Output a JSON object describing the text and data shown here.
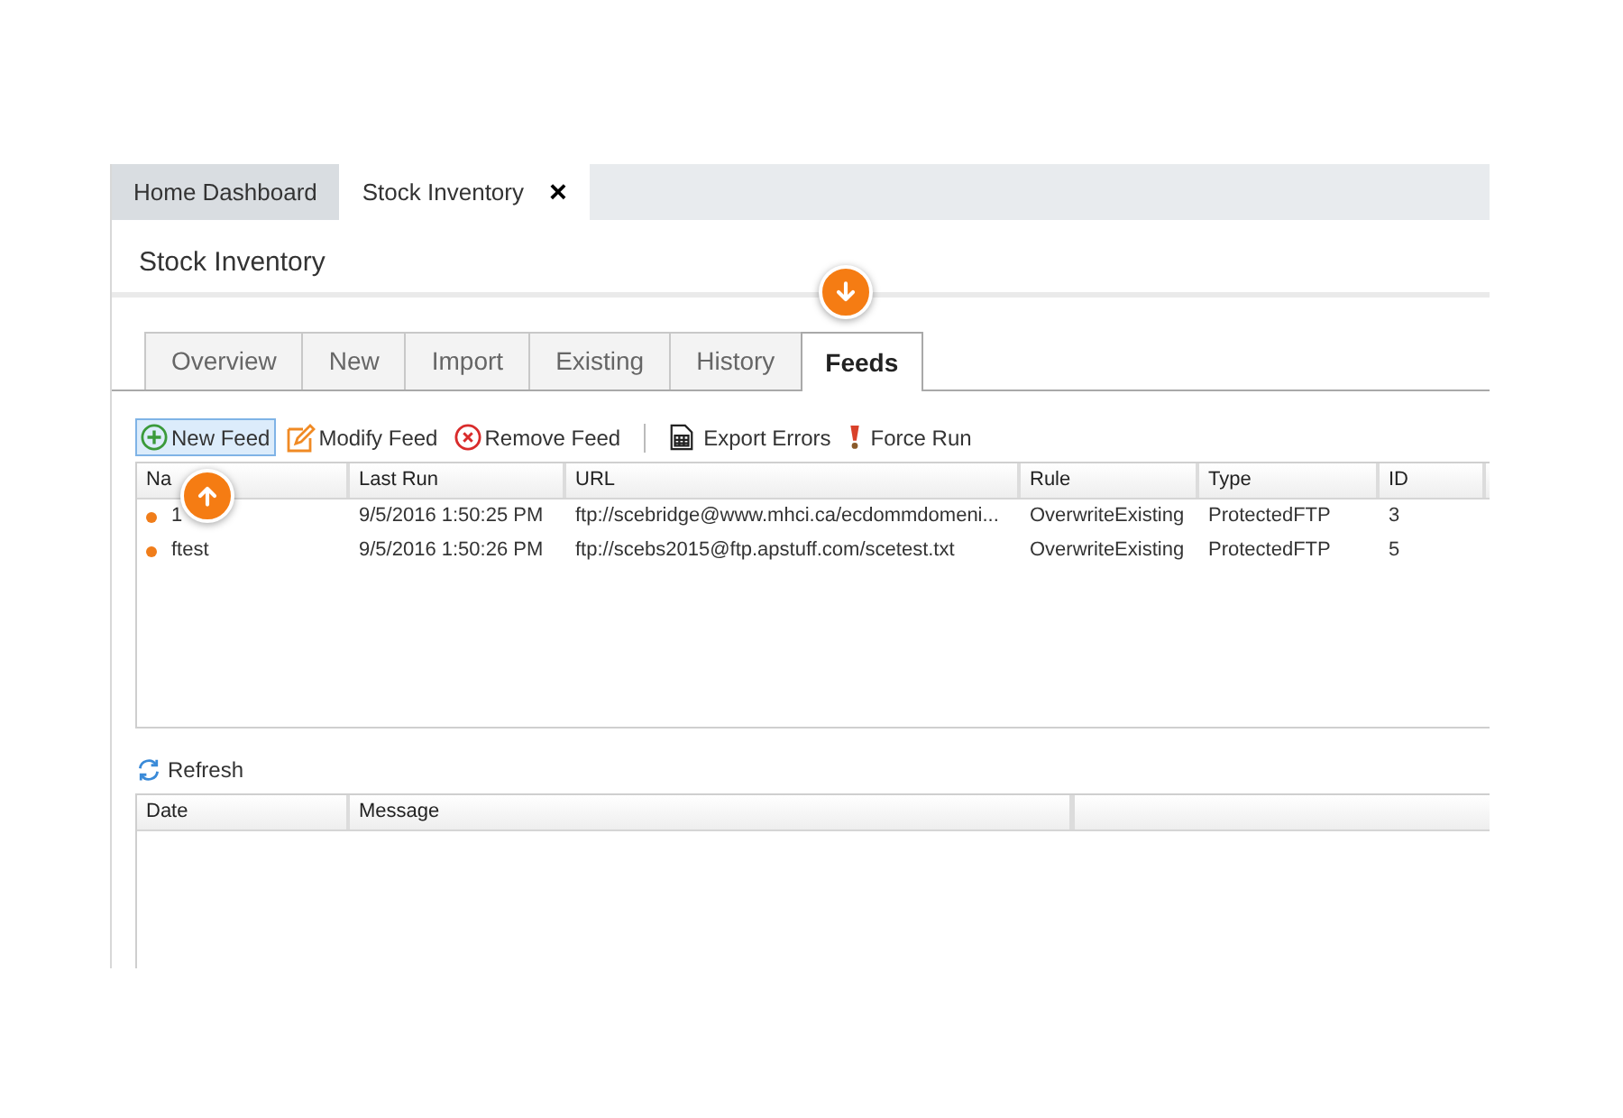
{
  "document_tabs": [
    {
      "label": "Home Dashboard",
      "selected": false
    },
    {
      "label": "Stock Inventory",
      "selected": true,
      "close": "×"
    }
  ],
  "page_title": "Stock Inventory",
  "tabs": [
    {
      "label": "Overview",
      "selected": false
    },
    {
      "label": "New",
      "selected": false
    },
    {
      "label": "Import",
      "selected": false
    },
    {
      "label": "Existing",
      "selected": false
    },
    {
      "label": "History",
      "selected": false
    },
    {
      "label": "Feeds",
      "selected": true
    }
  ],
  "toolbar": [
    {
      "label": "New Feed",
      "kind": "add",
      "highlighted": true
    },
    {
      "label": "Modify Feed",
      "kind": "edit",
      "highlighted": false
    },
    {
      "label": "Remove Feed",
      "kind": "remove",
      "highlighted": false
    },
    {
      "kind": "separator"
    },
    {
      "label": "Export Errors",
      "kind": "export",
      "highlighted": false
    },
    {
      "label": "Force Run",
      "kind": "force",
      "highlighted": false
    }
  ],
  "feeds_table": {
    "columns": [
      "Na",
      "Last Run",
      "URL",
      "Rule",
      "Type",
      "ID"
    ],
    "rows": [
      {
        "color": "#f07d1a",
        "cells": [
          "1",
          "9/5/2016 1:50:25 PM",
          "ftp://scebridge@www.mhci.ca/ecdommdomeni...",
          "OverwriteExisting",
          "ProtectedFTP",
          "3"
        ]
      },
      {
        "color": "#f07d1a",
        "cells": [
          "ftest",
          "9/5/2016 1:50:26 PM",
          "ftp://scebs2015@ftp.apstuff.com/scetest.txt",
          "OverwriteExisting",
          "ProtectedFTP",
          "5"
        ]
      }
    ]
  },
  "refresh_button": {
    "label": "Refresh"
  },
  "log_table": {
    "columns": [
      "Date",
      "Message"
    ]
  },
  "callouts": [
    {
      "kind": "down"
    },
    {
      "kind": "up"
    }
  ]
}
